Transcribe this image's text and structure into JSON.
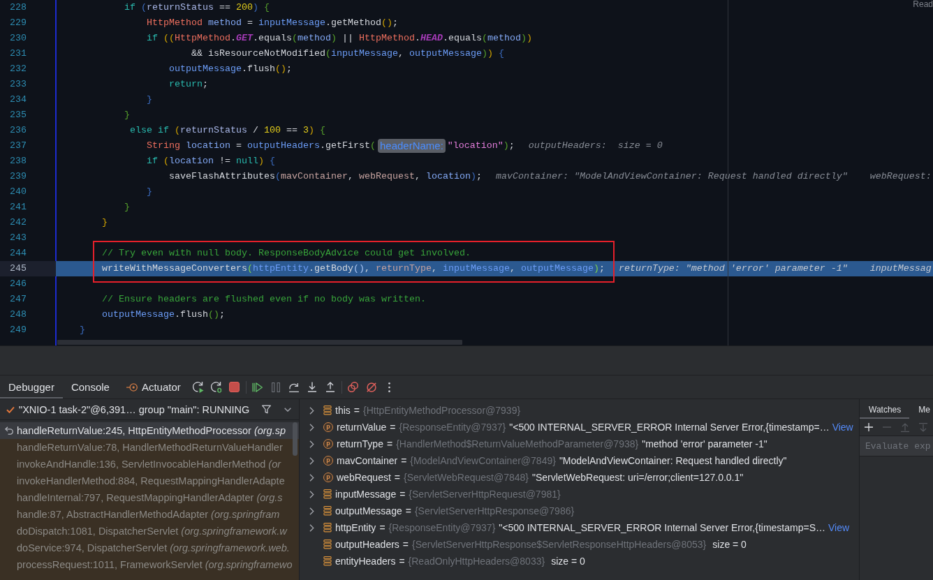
{
  "editor": {
    "reader_mode": "Read",
    "lines": [
      {
        "number": "228",
        "current": false,
        "framed": false,
        "code": [
          {
            "kind": "keyword",
            "text": "            if"
          },
          {
            "kind": "bracket3",
            "text": " ("
          },
          {
            "kind": "variable",
            "text": "returnStatus"
          },
          {
            "kind": "plain",
            "text": " == "
          },
          {
            "kind": "number",
            "text": "200"
          },
          {
            "kind": "bracket3",
            "text": ")"
          },
          {
            "kind": "bracket2",
            "text": " {"
          }
        ]
      },
      {
        "number": "229",
        "current": false,
        "framed": false,
        "code": [
          {
            "kind": "type",
            "text": "                HttpMethod"
          },
          {
            "kind": "local",
            "text": " method"
          },
          {
            "kind": "plain",
            "text": " = "
          },
          {
            "kind": "param",
            "text": "inputMessage"
          },
          {
            "kind": "plain",
            "text": "."
          },
          {
            "kind": "method",
            "text": "getMethod"
          },
          {
            "kind": "bracket1",
            "text": "()"
          },
          {
            "kind": "plain",
            "text": ";"
          }
        ]
      },
      {
        "number": "230",
        "current": false,
        "framed": false,
        "code": [
          {
            "kind": "keyword",
            "text": "                if"
          },
          {
            "kind": "bracket1",
            "text": " (("
          },
          {
            "kind": "type",
            "text": "HttpMethod"
          },
          {
            "kind": "plain",
            "text": "."
          },
          {
            "kind": "constant",
            "text": "GET"
          },
          {
            "kind": "plain",
            "text": "."
          },
          {
            "kind": "method",
            "text": "equals"
          },
          {
            "kind": "bracket2",
            "text": "("
          },
          {
            "kind": "local",
            "text": "method"
          },
          {
            "kind": "bracket2",
            "text": ")"
          },
          {
            "kind": "plain",
            "text": " || "
          },
          {
            "kind": "type",
            "text": "HttpMethod"
          },
          {
            "kind": "plain",
            "text": "."
          },
          {
            "kind": "constant",
            "text": "HEAD"
          },
          {
            "kind": "plain",
            "text": "."
          },
          {
            "kind": "method",
            "text": "equals"
          },
          {
            "kind": "bracket2",
            "text": "("
          },
          {
            "kind": "local",
            "text": "method"
          },
          {
            "kind": "bracket2",
            "text": ")"
          },
          {
            "kind": "bracket1",
            "text": ")"
          }
        ]
      },
      {
        "number": "231",
        "current": false,
        "framed": false,
        "code": [
          {
            "kind": "plain",
            "text": "                        && "
          },
          {
            "kind": "method",
            "text": "isResourceNotModified"
          },
          {
            "kind": "bracket2",
            "text": "("
          },
          {
            "kind": "param",
            "text": "inputMessage"
          },
          {
            "kind": "plain",
            "text": ", "
          },
          {
            "kind": "param",
            "text": "outputMessage"
          },
          {
            "kind": "bracket2",
            "text": ")"
          },
          {
            "kind": "bracket1",
            "text": ")"
          },
          {
            "kind": "bracket3",
            "text": " {"
          }
        ]
      },
      {
        "number": "232",
        "current": false,
        "framed": false,
        "code": [
          {
            "kind": "param",
            "text": "                    outputMessage"
          },
          {
            "kind": "plain",
            "text": "."
          },
          {
            "kind": "method",
            "text": "flush"
          },
          {
            "kind": "bracket1",
            "text": "()"
          },
          {
            "kind": "plain",
            "text": ";"
          }
        ]
      },
      {
        "number": "233",
        "current": false,
        "framed": false,
        "code": [
          {
            "kind": "keyword",
            "text": "                    return"
          },
          {
            "kind": "plain",
            "text": ";"
          }
        ]
      },
      {
        "number": "234",
        "current": false,
        "framed": false,
        "code": [
          {
            "kind": "bracket3",
            "text": "                }"
          }
        ]
      },
      {
        "number": "235",
        "current": false,
        "framed": false,
        "code": [
          {
            "kind": "bracket2",
            "text": "            }"
          }
        ]
      },
      {
        "number": "236",
        "current": false,
        "framed": false,
        "code": [
          {
            "kind": "keyword",
            "text": "             else if"
          },
          {
            "kind": "bracket1",
            "text": " ("
          },
          {
            "kind": "variable",
            "text": "returnStatus"
          },
          {
            "kind": "plain",
            "text": " / "
          },
          {
            "kind": "number",
            "text": "100"
          },
          {
            "kind": "plain",
            "text": " == "
          },
          {
            "kind": "number",
            "text": "3"
          },
          {
            "kind": "bracket1",
            "text": ")"
          },
          {
            "kind": "bracket2",
            "text": " {"
          }
        ]
      },
      {
        "number": "237",
        "current": false,
        "framed": false,
        "code": [
          {
            "kind": "type",
            "text": "                String"
          },
          {
            "kind": "local",
            "text": " location"
          },
          {
            "kind": "plain",
            "text": " = "
          },
          {
            "kind": "param",
            "text": "outputHeaders"
          },
          {
            "kind": "plain",
            "text": "."
          },
          {
            "kind": "method",
            "text": "getFirst"
          },
          {
            "kind": "bracket2",
            "text": "("
          },
          {
            "kind": "paramhint",
            "text": "headerName:"
          },
          {
            "kind": "string",
            "text": "\"location\""
          },
          {
            "kind": "bracket2",
            "text": ")"
          },
          {
            "kind": "plain",
            "text": ";"
          },
          {
            "kind": "valuehint",
            "text": "outputHeaders:  size = 0"
          }
        ]
      },
      {
        "number": "238",
        "current": false,
        "framed": false,
        "code": [
          {
            "kind": "keyword",
            "text": "                if"
          },
          {
            "kind": "bracket1",
            "text": " ("
          },
          {
            "kind": "local",
            "text": "location"
          },
          {
            "kind": "plain",
            "text": " != "
          },
          {
            "kind": "keyword",
            "text": "null"
          },
          {
            "kind": "bracket1",
            "text": ")"
          },
          {
            "kind": "bracket3",
            "text": " {"
          }
        ]
      },
      {
        "number": "239",
        "current": false,
        "framed": false,
        "code": [
          {
            "kind": "method",
            "text": "                    saveFlashAttributes"
          },
          {
            "kind": "bracket3",
            "text": "("
          },
          {
            "kind": "argument",
            "text": "mavContainer"
          },
          {
            "kind": "plain",
            "text": ", "
          },
          {
            "kind": "argument",
            "text": "webRequest"
          },
          {
            "kind": "plain",
            "text": ", "
          },
          {
            "kind": "local",
            "text": "location"
          },
          {
            "kind": "bracket3",
            "text": ")"
          },
          {
            "kind": "plain",
            "text": ";"
          },
          {
            "kind": "valuehint",
            "text": "mavContainer: \"ModelAndViewContainer: Request handled directly\""
          },
          {
            "kind": "valuehint",
            "text": "webRequest:"
          }
        ]
      },
      {
        "number": "240",
        "current": false,
        "framed": false,
        "code": [
          {
            "kind": "bracket3",
            "text": "                }"
          }
        ]
      },
      {
        "number": "241",
        "current": false,
        "framed": false,
        "code": [
          {
            "kind": "bracket2",
            "text": "            }"
          }
        ]
      },
      {
        "number": "242",
        "current": false,
        "framed": false,
        "code": [
          {
            "kind": "bracket1",
            "text": "        }"
          }
        ]
      },
      {
        "number": "243",
        "current": false,
        "framed": false
      },
      {
        "number": "244",
        "current": false,
        "framed": true,
        "code": [
          {
            "kind": "comment",
            "text": "        // Try even with null body. ResponseBodyAdvice could get involved."
          }
        ]
      },
      {
        "number": "245",
        "current": true,
        "framed": true,
        "code": [
          {
            "kind": "method",
            "text": "        writeWithMessageConverters"
          },
          {
            "kind": "bracket2",
            "text": "("
          },
          {
            "kind": "param",
            "text": "httpEntity"
          },
          {
            "kind": "plain",
            "text": "."
          },
          {
            "kind": "method",
            "text": "getBody"
          },
          {
            "kind": "bracket3",
            "text": "()"
          },
          {
            "kind": "plain",
            "text": ", "
          },
          {
            "kind": "argument",
            "text": "returnType"
          },
          {
            "kind": "plain",
            "text": ", "
          },
          {
            "kind": "param",
            "text": "inputMessage"
          },
          {
            "kind": "plain",
            "text": ", "
          },
          {
            "kind": "param",
            "text": "outputMessage"
          },
          {
            "kind": "bracket2",
            "text": ")"
          },
          {
            "kind": "plain",
            "text": ";"
          },
          {
            "kind": "valuehint",
            "text": "returnType: \"method 'error' parameter -1\""
          },
          {
            "kind": "valuehint",
            "text": "inputMessag"
          }
        ]
      },
      {
        "number": "246",
        "current": false,
        "framed": false
      },
      {
        "number": "247",
        "current": false,
        "framed": false,
        "code": [
          {
            "kind": "comment",
            "text": "        // Ensure headers are flushed even if no body was written."
          }
        ]
      },
      {
        "number": "248",
        "current": false,
        "framed": false,
        "code": [
          {
            "kind": "param",
            "text": "        outputMessage"
          },
          {
            "kind": "plain",
            "text": "."
          },
          {
            "kind": "method",
            "text": "flush"
          },
          {
            "kind": "bracket2",
            "text": "()"
          },
          {
            "kind": "plain",
            "text": ";"
          }
        ]
      },
      {
        "number": "249",
        "current": false,
        "framed": false,
        "code": [
          {
            "kind": "bracket3",
            "text": "    }"
          }
        ]
      }
    ]
  },
  "debugger": {
    "tabs": [
      {
        "label": "Debugger",
        "selected": true,
        "kind": "plain"
      },
      {
        "label": "Console",
        "selected": false,
        "kind": "plain"
      },
      {
        "label": "Actuator",
        "selected": false,
        "kind": "icon"
      }
    ],
    "toolbar": [
      {
        "buttons": [
          {
            "kind": "rerun",
            "disabled": false
          },
          {
            "kind": "debug",
            "disabled": false
          },
          {
            "kind": "stop",
            "disabled": false
          }
        ]
      },
      {
        "buttons": [
          {
            "kind": "resume",
            "disabled": false
          },
          {
            "kind": "pause",
            "disabled": true
          },
          {
            "kind": "stepover",
            "disabled": false
          },
          {
            "kind": "stepinto",
            "disabled": false
          },
          {
            "kind": "stepout",
            "disabled": false
          }
        ]
      },
      {
        "buttons": [
          {
            "kind": "breakpoints",
            "disabled": false
          },
          {
            "kind": "mute",
            "disabled": false
          },
          {
            "kind": "more",
            "disabled": false
          }
        ]
      }
    ],
    "thread": {
      "label": "\"XNIO-1 task-2\"@6,391… group \"main\": RUNNING"
    },
    "frames": [
      {
        "text": "handleReturnValue:245, HttpEntityMethodProcessor *(org.sp*",
        "selected": true
      },
      {
        "text": "handleReturnValue:78, HandlerMethodReturnValueHandler",
        "selected": false
      },
      {
        "text": "invokeAndHandle:136, ServletInvocableHandlerMethod *(or*",
        "selected": false
      },
      {
        "text": "invokeHandlerMethod:884, RequestMappingHandlerAdapte",
        "selected": false
      },
      {
        "text": "handleInternal:797, RequestMappingHandlerAdapter *(org.s*",
        "selected": false
      },
      {
        "text": "handle:87, AbstractHandlerMethodAdapter *(org.springfram*",
        "selected": false
      },
      {
        "text": "doDispatch:1081, DispatcherServlet *(org.springframework.w*",
        "selected": false
      },
      {
        "text": "doService:974, DispatcherServlet *(org.springframework.web.*",
        "selected": false
      },
      {
        "text": "processRequest:1011, FrameworkServlet *(org.springframewo*",
        "selected": false
      }
    ],
    "variables": [
      {
        "name": "this",
        "operator": "=",
        "type": "{HttpEntityMethodProcessor@7939}",
        "kind": "field",
        "expandable": true
      },
      {
        "name": "returnValue",
        "operator": "=",
        "type": "{ResponseEntity@7937}",
        "value": "\"<500 INTERNAL_SERVER_ERROR Internal Server Error,{timestamp=…",
        "link": "View",
        "kind": "param",
        "badge": "p",
        "expandable": true
      },
      {
        "name": "returnType",
        "operator": "=",
        "type": "{HandlerMethod$ReturnValueMethodParameter@7938}",
        "value": "\"method 'error' parameter -1\"",
        "kind": "param",
        "badge": "p",
        "expandable": true
      },
      {
        "name": "mavContainer",
        "operator": "=",
        "type": "{ModelAndViewContainer@7849}",
        "value": "\"ModelAndViewContainer: Request handled directly\"",
        "kind": "param",
        "badge": "p",
        "expandable": true
      },
      {
        "name": "webRequest",
        "operator": "=",
        "type": "{ServletWebRequest@7848}",
        "value": "\"ServletWebRequest: uri=/error;client=127.0.0.1\"",
        "kind": "param",
        "badge": "p",
        "expandable": true
      },
      {
        "name": "inputMessage",
        "operator": "=",
        "type": "{ServletServerHttpRequest@7981}",
        "kind": "field",
        "expandable": true
      },
      {
        "name": "outputMessage",
        "operator": "=",
        "type": "{ServletServerHttpResponse@7986}",
        "kind": "field",
        "expandable": true
      },
      {
        "name": "httpEntity",
        "operator": "=",
        "type": "{ResponseEntity@7937}",
        "value": "\"<500 INTERNAL_SERVER_ERROR Internal Server Error,{timestamp=S…",
        "link": "View",
        "kind": "field",
        "expandable": true
      },
      {
        "name": "outputHeaders",
        "operator": "=",
        "type": "{ServletServerHttpResponse$ServletResponseHttpHeaders@8053}",
        "size": "size = 0",
        "kind": "field",
        "expandable": false
      },
      {
        "name": "entityHeaders",
        "operator": "=",
        "type": "{ReadOnlyHttpHeaders@8033}",
        "size": "size = 0",
        "kind": "field",
        "expandable": false
      }
    ],
    "watches": {
      "tabs": [
        {
          "label": "Watches",
          "selected": true
        },
        {
          "label": "Me",
          "selected": false
        }
      ],
      "toolbar": [
        {
          "kind": "add",
          "disabled": false
        },
        {
          "kind": "remove",
          "disabled": true
        },
        {
          "kind": "up",
          "disabled": true
        },
        {
          "kind": "down",
          "disabled": true
        }
      ],
      "expression": {
        "placeholder": "Evaluate exp"
      }
    }
  }
}
